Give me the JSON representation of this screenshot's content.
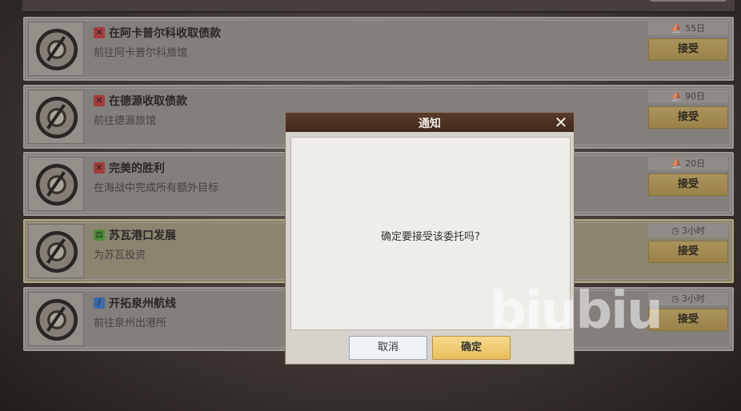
{
  "quests": [
    {
      "icon": "crossed-swords-icon",
      "icon_color": "#b33f3f",
      "title": "在阿卡普尔科收取债款",
      "desc": "前往阿卡普尔科旅馆",
      "time": "55日",
      "time_icon": "ship-icon",
      "button": "接受",
      "highlight": false
    },
    {
      "icon": "crossed-swords-icon",
      "icon_color": "#b33f3f",
      "title": "在德源收取债款",
      "desc": "前往德源旅馆",
      "time": "90日",
      "time_icon": "ship-icon",
      "button": "接受",
      "highlight": false
    },
    {
      "icon": "crossed-swords-icon",
      "icon_color": "#b33f3f",
      "title": "完美的胜利",
      "desc": "在海战中完成所有额外目标",
      "time": "20日",
      "time_icon": "ship-icon",
      "button": "接受",
      "highlight": false
    },
    {
      "icon": "scales-icon",
      "icon_color": "#4f9a3d",
      "title": "苏瓦港口发展",
      "desc": "为苏瓦投资",
      "time": "3小时",
      "time_icon": "clock-icon",
      "button": "接受",
      "highlight": true
    },
    {
      "icon": "sword-icon",
      "icon_color": "#3d74b7",
      "title": "开拓泉州航线",
      "desc": "前往泉州出港所",
      "time": "3小时",
      "time_icon": "clock-icon",
      "button": "接受",
      "highlight": false
    }
  ],
  "dialog": {
    "title": "通知",
    "message": "确定要接受该委托吗?",
    "cancel_label": "取消",
    "confirm_label": "确定"
  },
  "watermark": "biubiu"
}
